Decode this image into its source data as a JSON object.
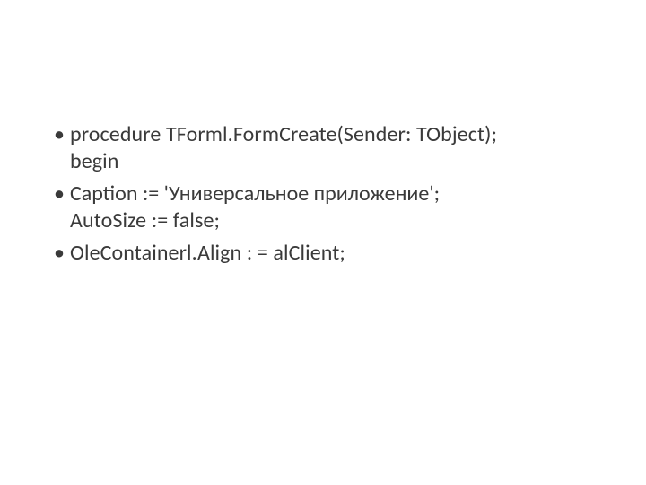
{
  "bullets": [
    {
      "line1": "procedure TForml.FormCreate(Sender: TObject); begin",
      "line1_a": "procedure TForml.FormCreate(Sender: TObject);",
      "line1_b": "begin"
    },
    {
      "line2_a": "Caption := 'Универсальное приложение';",
      "line2_b": "AutoSize := false;"
    },
    {
      "line3": "OleContainerl.Align : = alClient;"
    }
  ]
}
